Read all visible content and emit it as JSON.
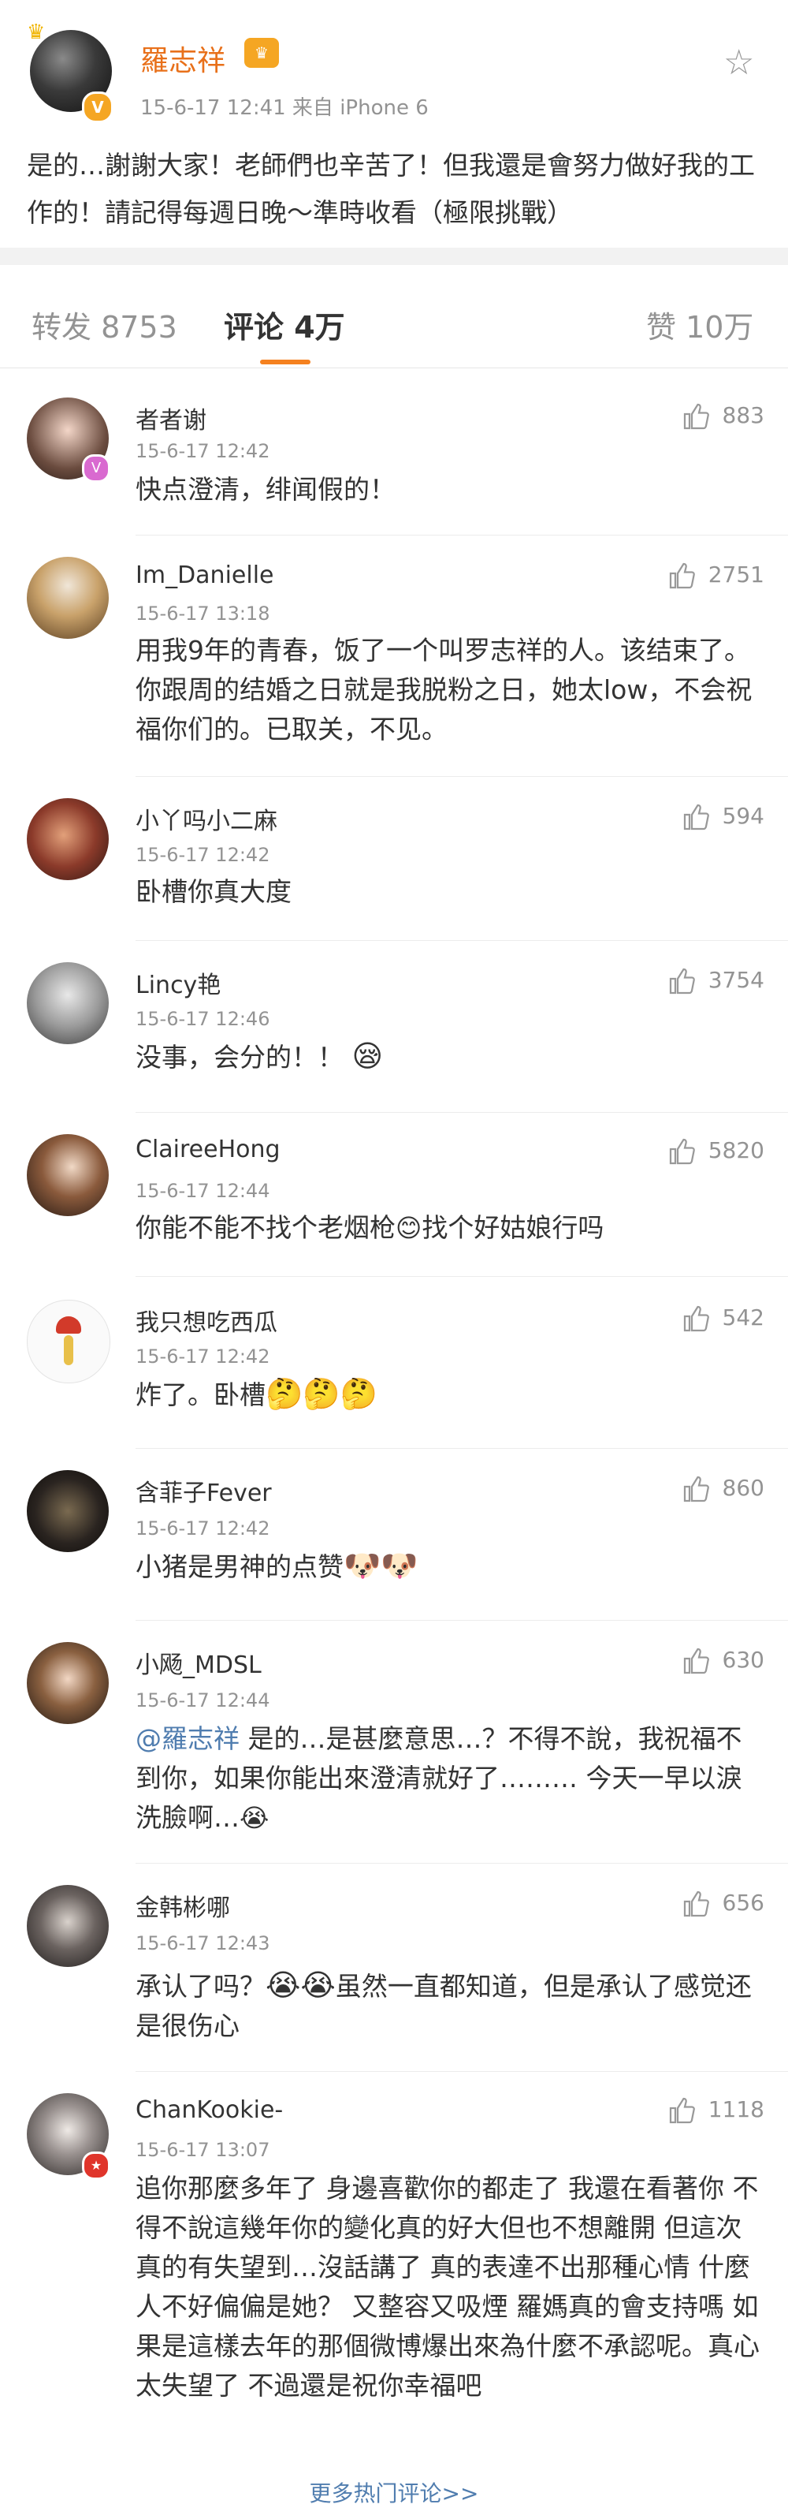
{
  "post": {
    "author": "羅志祥",
    "meta": "15-6-17 12:41  来自 iPhone 6",
    "text": "是的…謝謝大家！老師們也辛苦了！但我還是會努力做好我的工作的！請記得每週日晚～準時收看（極限挑戰）"
  },
  "tabs": {
    "repost": "转发 8753",
    "comments": "评论 4万",
    "likes": "赞 10万"
  },
  "comments": [
    {
      "name": "者者谢",
      "time": "15-6-17 12:42",
      "text": "快点澄清，绯闻假的！",
      "likes": "883"
    },
    {
      "name": "Im_Danielle",
      "time": "15-6-17 13:18",
      "text": "用我9年的青春，饭了一个叫罗志祥的人。该结束了。你跟周的结婚之日就是我脱粉之日，她太low，不会祝福你们的。已取关，不见。",
      "likes": "2751"
    },
    {
      "name": "小丫吗小二麻",
      "time": "15-6-17 12:42",
      "text": "卧槽你真大度",
      "likes": "594"
    },
    {
      "name": "Lincy艳",
      "time": "15-6-17 12:46",
      "text": "没事，会分的！！",
      "likes": "3754"
    },
    {
      "name": "ClaireeHong",
      "time": "15-6-17 12:44",
      "text_a": "你能不能不找个老烟枪",
      "text_b": "找个好姑娘行吗",
      "likes": "5820"
    },
    {
      "name": "我只想吃西瓜",
      "time": "15-6-17 12:42",
      "text": "炸了。卧槽",
      "likes": "542"
    },
    {
      "name": "含菲子Fever",
      "time": "15-6-17 12:42",
      "text": "小猪是男神的点赞",
      "likes": "860"
    },
    {
      "name": "小飏_MDSL",
      "time": "15-6-17 12:44",
      "mention": "@羅志祥",
      "text": " 是的…是甚麼意思…？不得不說，我祝福不到你，如果你能出來澄清就好了……… 今天一早以淚洗臉啊…",
      "likes": "630"
    },
    {
      "name": "金韩彬哪",
      "time": "15-6-17 12:43",
      "text_a": "承认了吗？",
      "text_b": "虽然一直都知道，但是承认了感觉还是很伤心",
      "likes": "656"
    },
    {
      "name": "ChanKookie-",
      "time": "15-6-17 13:07",
      "text": "追你那麼多年了 身邊喜歡你的都走了 我還在看著你 不得不說這幾年你的變化真的好大但也不想離開 但這次真的有失望到…沒話講了 真的表達不出那種心情 什麼人不好偏偏是她？ 又整容又吸煙 羅媽真的會支持嗎 如果是這樣去年的那個微博爆出來為什麼不承認呢。真心太失望了 不過還是祝你幸福吧",
      "likes": "1118"
    }
  ],
  "more_link": "更多热门评论>>",
  "icons": {
    "like": "thumbs-up-icon",
    "star": "star-icon",
    "verified": "verified-v-icon"
  },
  "colors": {
    "author": "#e8701a",
    "accent": "#f5811f",
    "link": "#507daf",
    "muted": "#939393"
  }
}
